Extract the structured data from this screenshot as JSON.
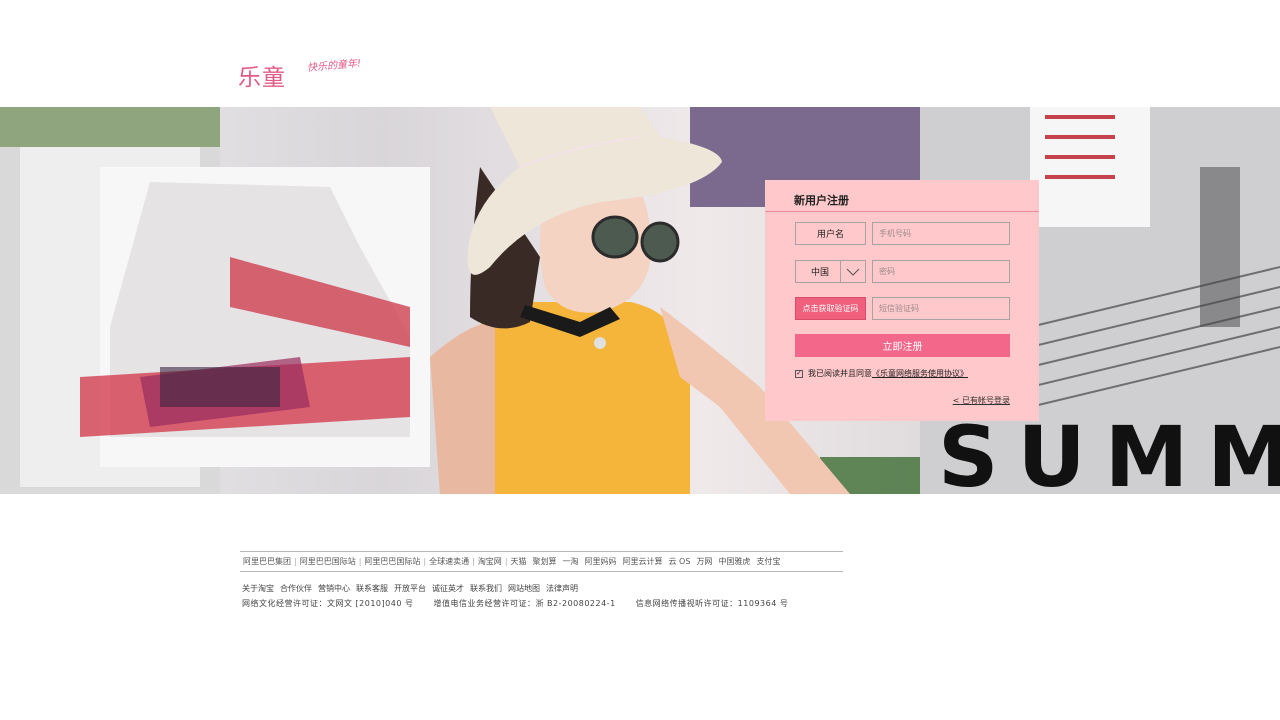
{
  "header": {
    "logo": "乐童",
    "slogan": "快乐的童年!"
  },
  "banner": {
    "big_text": "SUMM"
  },
  "register": {
    "title": "新用户注册",
    "username_label": "用户名",
    "phone_placeholder": "手机号码",
    "country_value": "中国",
    "password_placeholder": "密码",
    "get_code_label": "点击获取验证码",
    "sms_placeholder": "短信验证码",
    "submit_label": "立即注册",
    "agree_prefix": "我已阅读并且同意",
    "agree_link": "《乐童网络服务使用协议》",
    "login_link": "< 已有帐号登录"
  },
  "footer": {
    "links": [
      "阿里巴巴集团",
      "阿里巴巴国际站",
      "阿里巴巴国际站",
      "全球速卖通",
      "淘宝网",
      "天猫",
      "聚划算",
      "一淘",
      "阿里妈妈",
      "阿里云计算",
      "云 OS",
      "万网",
      "中国雅虎",
      "支付宝"
    ],
    "secondary": [
      "关于淘宝",
      "合作伙伴",
      "营销中心",
      "联系客服",
      "开放平台",
      "诚征英才",
      "联系我们",
      "网站地图",
      "法律声明"
    ],
    "licenses": [
      "网络文化经营许可证：文网文 [2010]040 号",
      "增值电信业务经营许可证：浙 B2-20080224-1",
      "信息网络传播视听许可证：1109364 号"
    ]
  },
  "colors": {
    "brand_pink": "#e35a86",
    "panel_bg": "#ffc8ca",
    "button_pink": "#f3678a"
  }
}
